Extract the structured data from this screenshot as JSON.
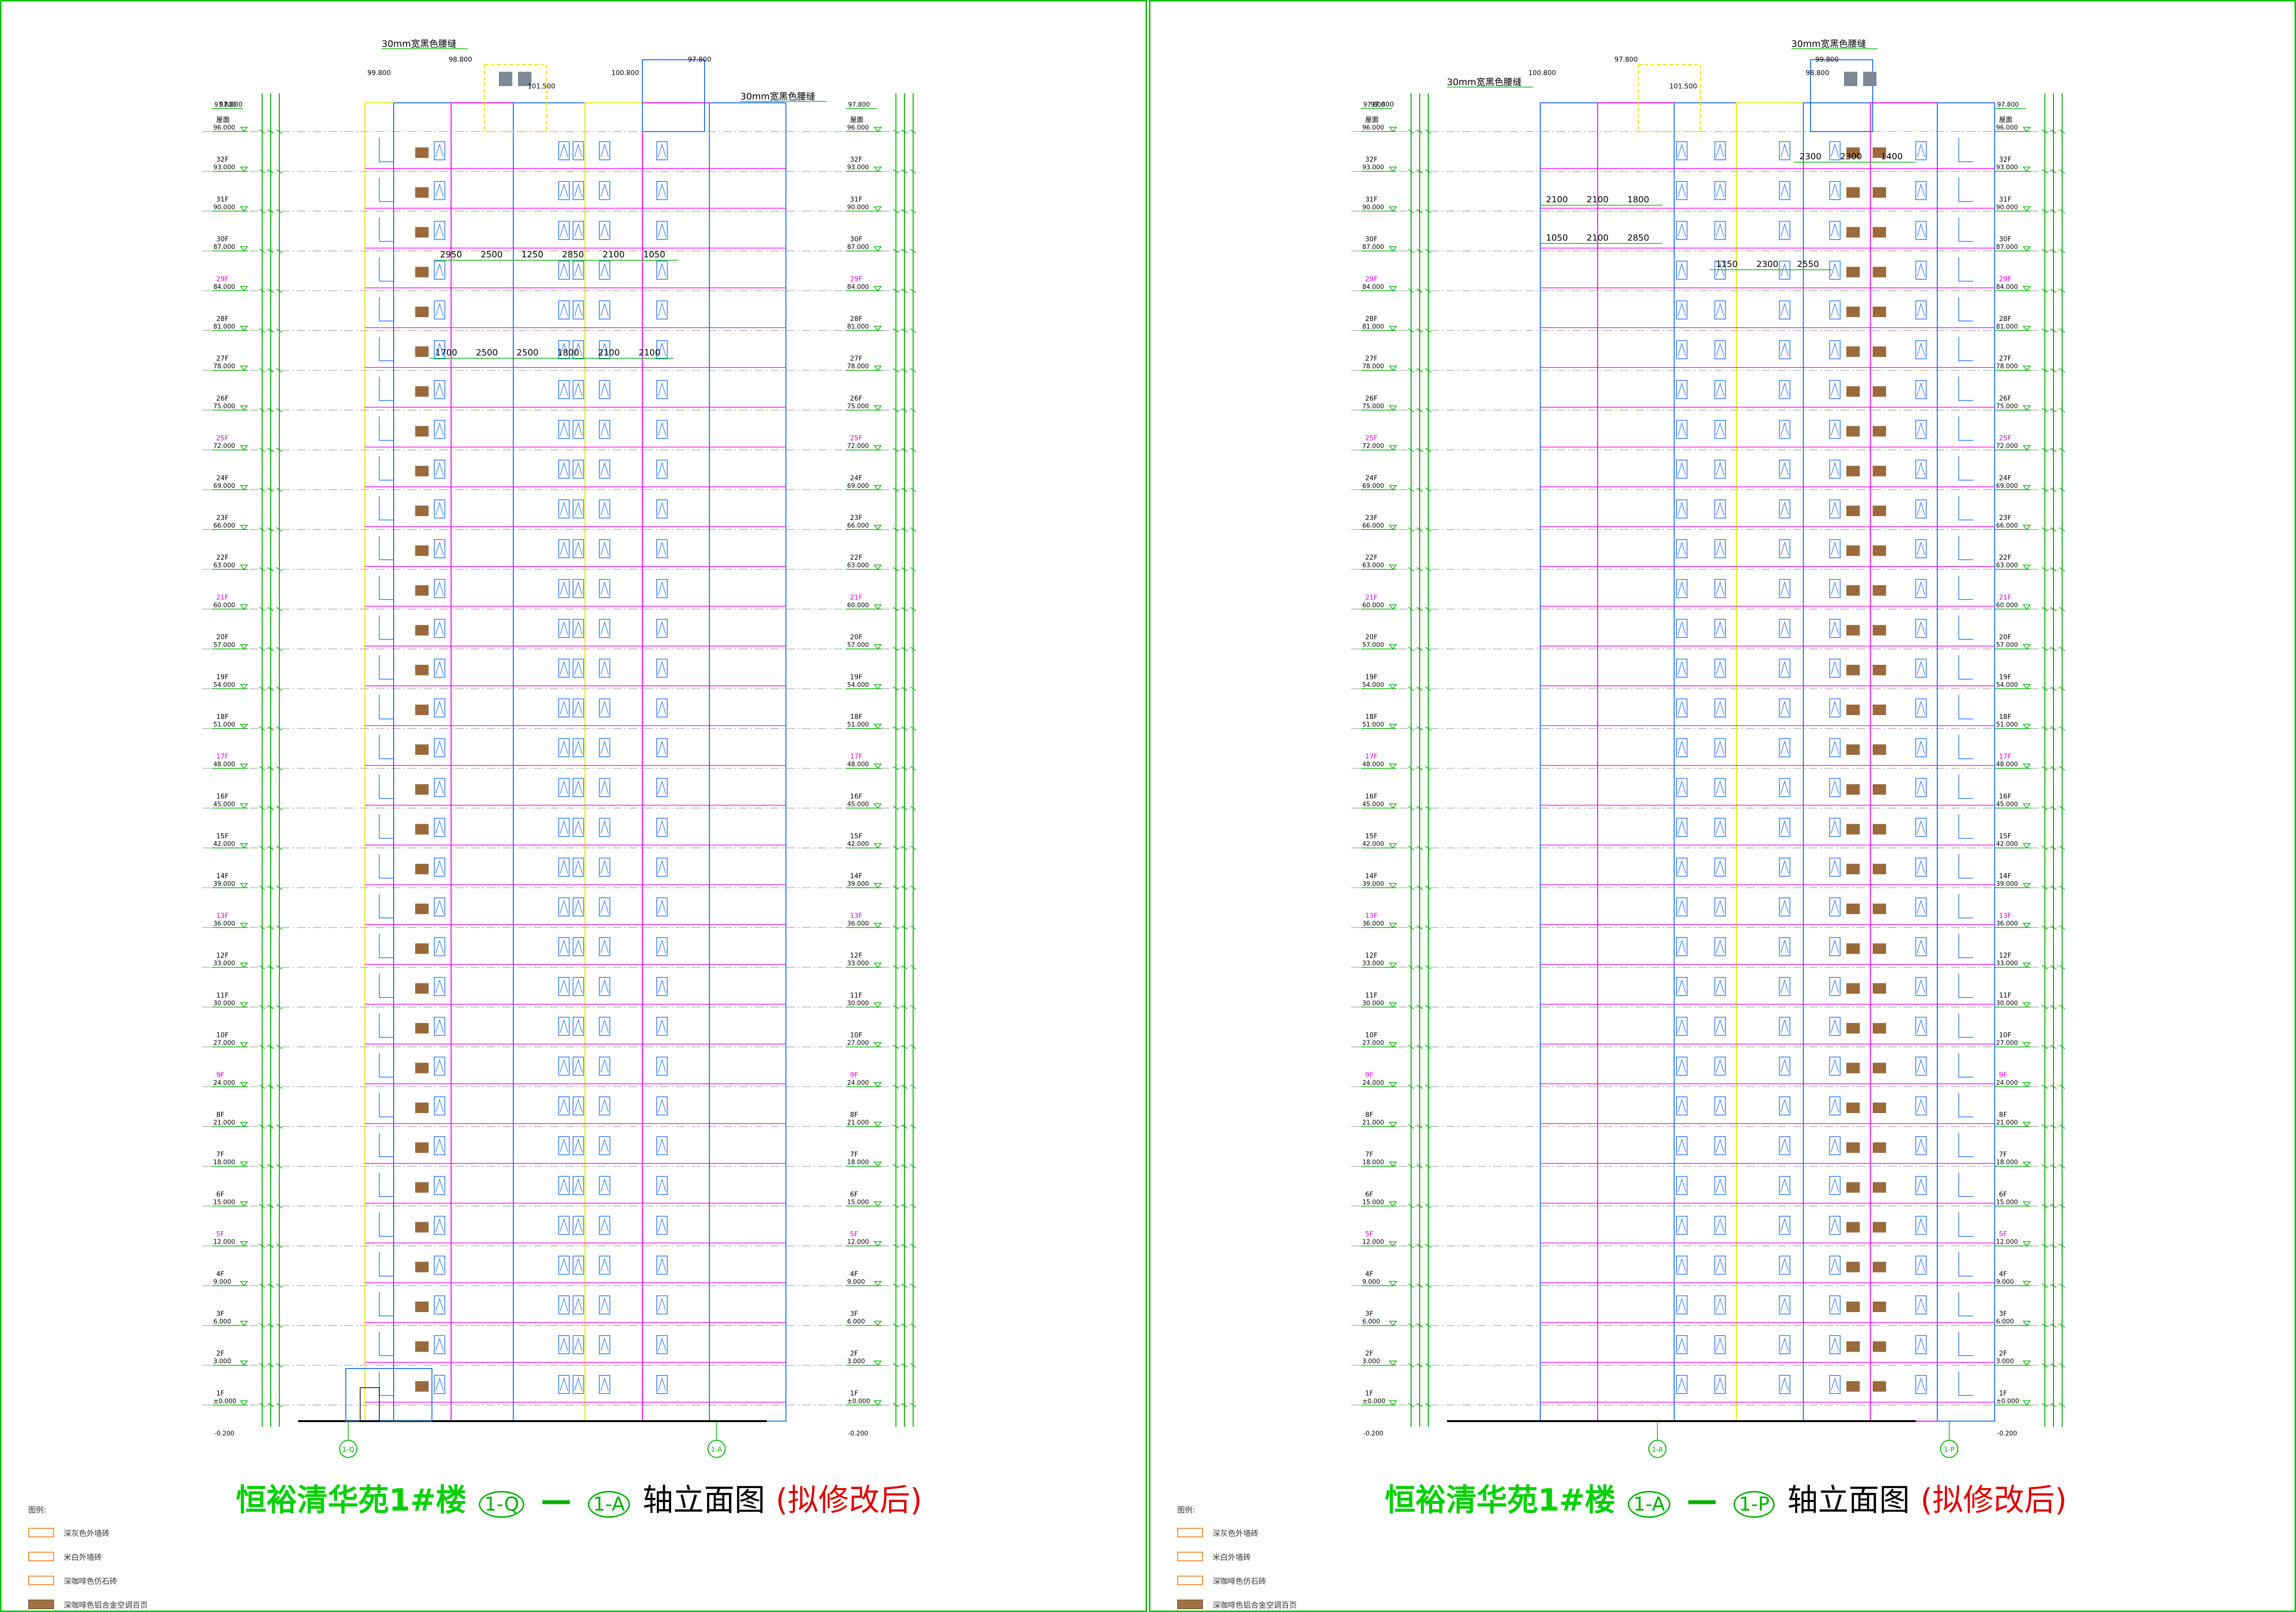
{
  "sheets": [
    {
      "id": "left",
      "title": {
        "project": "恒裕清华苑1#楼",
        "axis_from": "1-Q",
        "dash": "—",
        "axis_to": "1-A",
        "suffix": "轴立面图",
        "note": "(拟修改后)"
      },
      "axis_bubbles": [
        "1-Q",
        "1-A"
      ],
      "top_elevations": [
        "97.800",
        "99.800",
        "98.800",
        "101.500",
        "100.800",
        "97.800"
      ],
      "annotations": [
        "30mm宽黑色腰缝",
        "30mm宽黑色腰缝"
      ],
      "dimension_rows": [
        [
          "2950",
          "2500",
          "1250",
          "2850",
          "2100",
          "1050"
        ],
        [
          "1700",
          "2500",
          "2500",
          "1800",
          "2100",
          "2100"
        ]
      ]
    },
    {
      "id": "right",
      "title": {
        "project": "恒裕清华苑1#楼",
        "axis_from": "1-A",
        "dash": "—",
        "axis_to": "1-P",
        "suffix": "轴立面图",
        "note": "(拟修改后)"
      },
      "axis_bubbles": [
        "1-A",
        "1-P"
      ],
      "top_elevations": [
        "97.800",
        "100.800",
        "97.800",
        "101.500",
        "98.800",
        "99.800"
      ],
      "annotations": [
        "30mm宽黑色腰缝",
        "30mm宽黑色腰缝"
      ],
      "dimension_rows": [
        [
          "2300",
          "2300",
          "1400"
        ],
        [
          "2100",
          "2100",
          "1800"
        ],
        [
          "1050",
          "2100",
          "2850"
        ],
        [
          "1150",
          "2300",
          "2550"
        ]
      ]
    }
  ],
  "floors": [
    {
      "label": "屋面",
      "elev": "96.000"
    },
    {
      "label": "32F",
      "elev": "93.000"
    },
    {
      "label": "31F",
      "elev": "90.000"
    },
    {
      "label": "30F",
      "elev": "87.000"
    },
    {
      "label": "29F",
      "elev": "84.000"
    },
    {
      "label": "28F",
      "elev": "81.000"
    },
    {
      "label": "27F",
      "elev": "78.000"
    },
    {
      "label": "26F",
      "elev": "75.000"
    },
    {
      "label": "25F",
      "elev": "72.000"
    },
    {
      "label": "24F",
      "elev": "69.000"
    },
    {
      "label": "23F",
      "elev": "66.000"
    },
    {
      "label": "22F",
      "elev": "63.000"
    },
    {
      "label": "21F",
      "elev": "60.000"
    },
    {
      "label": "20F",
      "elev": "57.000"
    },
    {
      "label": "19F",
      "elev": "54.000"
    },
    {
      "label": "18F",
      "elev": "51.000"
    },
    {
      "label": "17F",
      "elev": "48.000"
    },
    {
      "label": "16F",
      "elev": "45.000"
    },
    {
      "label": "15F",
      "elev": "42.000"
    },
    {
      "label": "14F",
      "elev": "39.000"
    },
    {
      "label": "13F",
      "elev": "36.000"
    },
    {
      "label": "12F",
      "elev": "33.000"
    },
    {
      "label": "11F",
      "elev": "30.000"
    },
    {
      "label": "10F",
      "elev": "27.000"
    },
    {
      "label": "9F",
      "elev": "24.000"
    },
    {
      "label": "8F",
      "elev": "21.000"
    },
    {
      "label": "7F",
      "elev": "18.000"
    },
    {
      "label": "6F",
      "elev": "15.000"
    },
    {
      "label": "5F",
      "elev": "12.000"
    },
    {
      "label": "4F",
      "elev": "9.000"
    },
    {
      "label": "3F",
      "elev": "6.000"
    },
    {
      "label": "2F",
      "elev": "3.000"
    },
    {
      "label": "1F",
      "elev": "±0.000"
    }
  ],
  "highlight_floors": [
    "29F",
    "25F",
    "21F",
    "17F",
    "13F",
    "9F",
    "5F"
  ],
  "ground_elev": "-0.200",
  "top_elev": "97.800",
  "legend": {
    "title": "图例:",
    "items": [
      "深灰色外墙砖",
      "米白外墙砖",
      "深咖啡色仿石砖",
      "深咖啡色铝合金空调百页"
    ]
  },
  "colors": {
    "frame": "#00c400",
    "floor_line": "#ff00ff",
    "wall_blue": "#1e6fff",
    "wall_yellow": "#e6e600",
    "grid": "#00b000",
    "louver": "#9a6a3c",
    "highlight": "#e000e0",
    "title_green": "#00d000",
    "title_red": "#e00000"
  }
}
